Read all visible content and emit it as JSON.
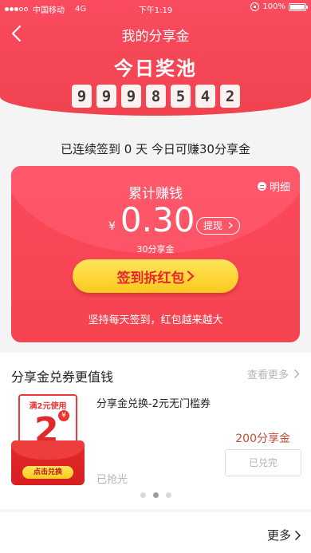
{
  "status_bar": {
    "carrier": "中国移动",
    "network": "4G",
    "time": "下午1:19",
    "battery": "100%"
  },
  "nav": {
    "title": "我的分享金"
  },
  "pool": {
    "title": "今日奖池",
    "digits": [
      "9",
      "9",
      "9",
      "8",
      "5",
      "4",
      "2"
    ]
  },
  "streak_text": "已连续签到 0 天 今日可赚30分享金",
  "card": {
    "detail_label": "明细",
    "accumulated_label": "累计赚钱",
    "currency": "¥",
    "amount": "0.30",
    "cashout_label": "提现",
    "amount_sub": "30分享金",
    "sign_button_label": "签到拆红包",
    "hint": "坚持每天签到，红包越来越大"
  },
  "exchange": {
    "title": "分享金兑券更值钱",
    "more_label": "查看更多",
    "coupon": {
      "image_top_text": "满2元使用",
      "image_value": "2",
      "image_badge": "¥",
      "image_button": "点击兑换",
      "name": "分享金兑换-2元无门槛券",
      "price": "200分享金",
      "action_label": "已兑完",
      "grabbed_label": "已抢光"
    },
    "page_count": 3,
    "active_page": 2
  },
  "bottom": {
    "more_label": "更多"
  },
  "colors": {
    "primary_red": "#f5434f",
    "button_yellow": "#fbc91d",
    "price_color": "#c44937"
  }
}
